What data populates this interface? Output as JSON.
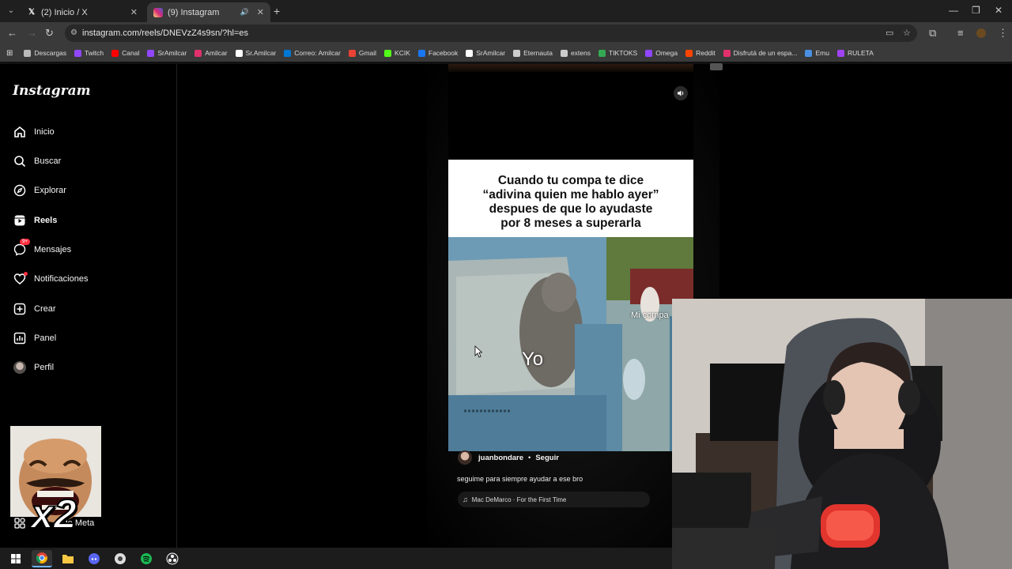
{
  "browser": {
    "tabs": [
      {
        "label": "(2) Inicio / X",
        "icon": "x-logo-icon"
      },
      {
        "label": "(9) Instagram",
        "icon": "instagram-icon",
        "active": true
      }
    ],
    "url": "instagram.com/reels/DNEVzZ4s9sn/?hl=es",
    "bookmarks": [
      {
        "label": "Descargas",
        "color": "#bbbbbb"
      },
      {
        "label": "Twitch",
        "color": "#9146ff"
      },
      {
        "label": "Canal",
        "color": "#ff0000"
      },
      {
        "label": "SrAmilcar",
        "color": "#9146ff"
      },
      {
        "label": "Amilcar",
        "color": "#e1306c"
      },
      {
        "label": "Sr.Amilcar",
        "color": "#ffffff"
      },
      {
        "label": "Correo: Amilcar",
        "color": "#0078d4"
      },
      {
        "label": "Gmail",
        "color": "#ea4335"
      },
      {
        "label": "KCIK",
        "color": "#53fc18"
      },
      {
        "label": "Facebook",
        "color": "#1877f2"
      },
      {
        "label": "SrAmilcar",
        "color": "#ffffff"
      },
      {
        "label": "Eternauta",
        "color": "#cccccc"
      },
      {
        "label": "extens",
        "color": "#cccccc"
      },
      {
        "label": "TIKTOKS",
        "color": "#34a853"
      },
      {
        "label": "Omega",
        "color": "#9146ff"
      },
      {
        "label": "Reddit",
        "color": "#ff4500"
      },
      {
        "label": "Disfrutá de un espa...",
        "color": "#e1306c"
      },
      {
        "label": "Emu",
        "color": "#4a90e2"
      },
      {
        "label": "RULETA",
        "color": "#a142f4"
      }
    ]
  },
  "sidebar": {
    "logo": "Instagram",
    "items": [
      {
        "label": "Inicio",
        "icon": "home-icon"
      },
      {
        "label": "Buscar",
        "icon": "search-icon"
      },
      {
        "label": "Explorar",
        "icon": "compass-icon"
      },
      {
        "label": "Reels",
        "icon": "reels-icon"
      },
      {
        "label": "Mensajes",
        "icon": "messenger-icon",
        "badge": "9+"
      },
      {
        "label": "Notificaciones",
        "icon": "heart-icon"
      },
      {
        "label": "Crear",
        "icon": "plus-square-icon"
      },
      {
        "label": "Panel",
        "icon": "chart-icon"
      },
      {
        "label": "Perfil",
        "icon": "profile-avatar"
      }
    ],
    "meta_label": "s de Meta",
    "emote_text": "x2"
  },
  "reel": {
    "caption_lines": [
      "Cuando tu compa te dice",
      "“adivina quien me hablo ayer”",
      "despues de que lo ayudaste",
      "por 8 meses a superarla"
    ],
    "overlay_yo": "Yo",
    "overlay_micompa": "Mi compa",
    "author": "juanbondare",
    "separator": "•",
    "follow": "Seguir",
    "description": "seguime para siempre ayudar a ese bro",
    "music": "Mac DeMarco · For the First Time"
  }
}
